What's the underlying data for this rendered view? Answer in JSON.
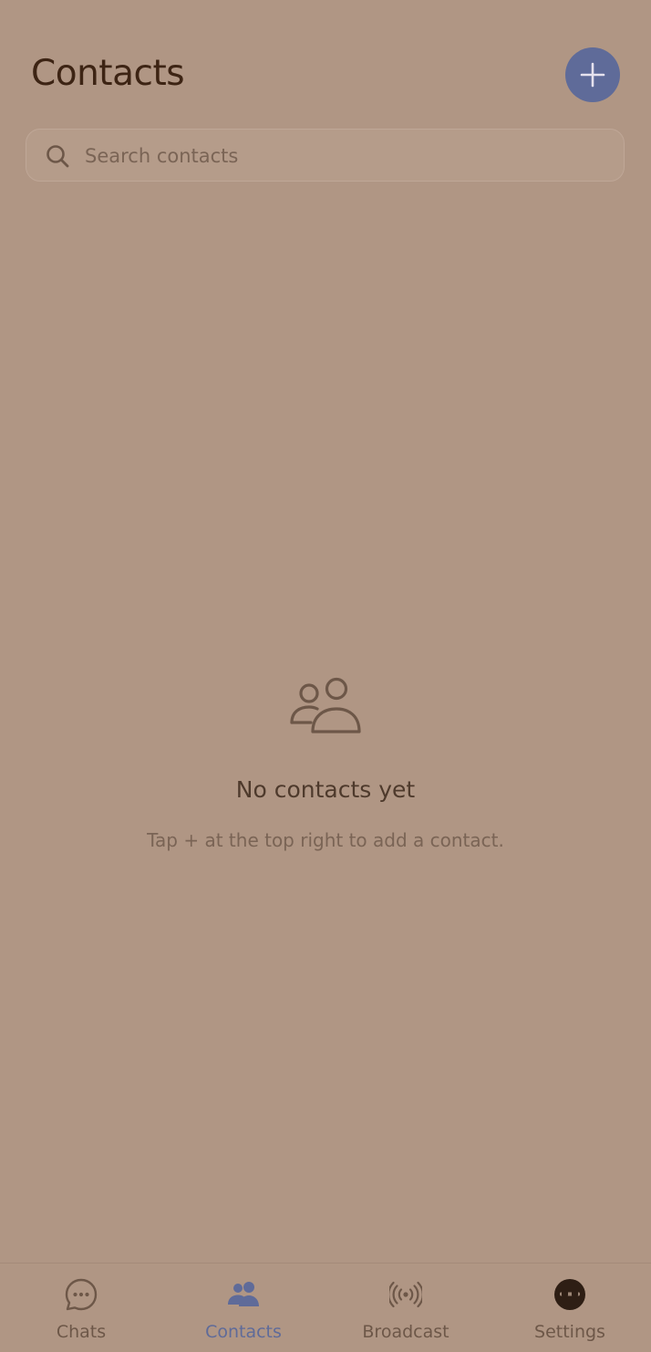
{
  "header": {
    "title": "Contacts",
    "add_button_icon": "plus-icon"
  },
  "search": {
    "placeholder": "Search contacts",
    "value": "",
    "icon": "search-icon"
  },
  "empty_state": {
    "icon": "people-icon",
    "title": "No contacts yet",
    "subtitle": "Tap + at the top right to add a contact."
  },
  "tabbar": {
    "tabs": [
      {
        "label": "Chats",
        "icon": "chat-bubble-icon",
        "active": false
      },
      {
        "label": "Contacts",
        "icon": "people-icon",
        "active": true
      },
      {
        "label": "Broadcast",
        "icon": "broadcast-icon",
        "active": false
      },
      {
        "label": "Settings",
        "icon": "avatar-icon",
        "active": false
      }
    ]
  },
  "colors": {
    "background": "#b09684",
    "accent": "#5f6b99",
    "title_text": "#3d2414",
    "muted_text": "#7a6455"
  }
}
